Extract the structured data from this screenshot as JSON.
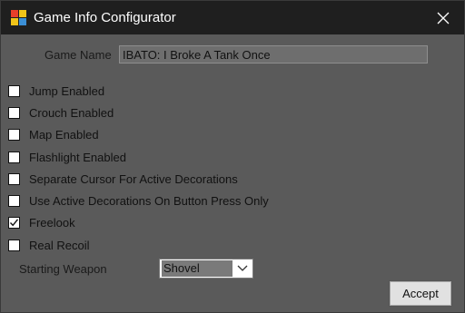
{
  "window": {
    "title": "Game Info Configurator"
  },
  "form": {
    "game_name_label": "Game Name",
    "game_name_value": "IBATO: I Broke A Tank Once",
    "checkboxes": [
      {
        "label": "Jump Enabled",
        "checked": false
      },
      {
        "label": "Crouch Enabled",
        "checked": false
      },
      {
        "label": "Map Enabled",
        "checked": false
      },
      {
        "label": "Flashlight Enabled",
        "checked": false
      },
      {
        "label": "Separate Cursor For Active Decorations",
        "checked": false
      },
      {
        "label": "Use Active Decorations On Button Press Only",
        "checked": false
      },
      {
        "label": "Freelook",
        "checked": true
      },
      {
        "label": "Real Recoil",
        "checked": false
      }
    ],
    "starting_weapon_label": "Starting Weapon",
    "starting_weapon_value": "Shovel",
    "accept_label": "Accept"
  },
  "colors": {
    "titlebar": "#1f1f1f",
    "client_bg": "#5a5a5a"
  },
  "icons": {
    "app": "app-icon",
    "close": "close-icon",
    "dropdown": "chevron-down-icon",
    "check": "checkmark-icon"
  }
}
